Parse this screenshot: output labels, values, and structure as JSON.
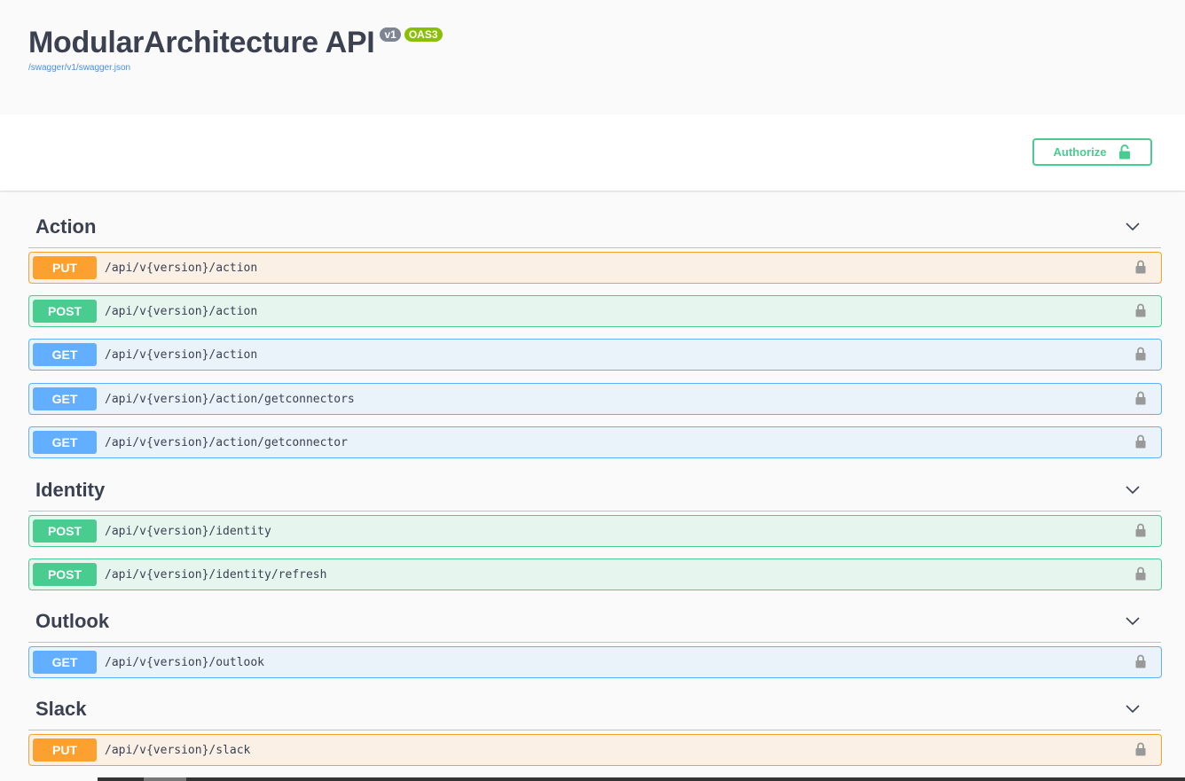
{
  "info": {
    "title": "ModularArchitecture API",
    "version_badge": "v1",
    "oas_badge": "OAS3",
    "spec_link": "/swagger/v1/swagger.json"
  },
  "scheme": {
    "authorize_label": "Authorize",
    "authorize_icon": "lock-open-icon"
  },
  "colors": {
    "put": "#fca130",
    "post": "#49cc90",
    "get": "#61affe",
    "badge_version": "#7d8492",
    "badge_oas": "#89bf04",
    "link": "#4990e2"
  },
  "tags": [
    {
      "name": "Action",
      "operations": [
        {
          "method": "PUT",
          "path": "/api/v{version}/action"
        },
        {
          "method": "POST",
          "path": "/api/v{version}/action"
        },
        {
          "method": "GET",
          "path": "/api/v{version}/action"
        },
        {
          "method": "GET",
          "path": "/api/v{version}/action/getconnectors"
        },
        {
          "method": "GET",
          "path": "/api/v{version}/action/getconnector"
        }
      ]
    },
    {
      "name": "Identity",
      "operations": [
        {
          "method": "POST",
          "path": "/api/v{version}/identity"
        },
        {
          "method": "POST",
          "path": "/api/v{version}/identity/refresh"
        }
      ]
    },
    {
      "name": "Outlook",
      "operations": [
        {
          "method": "GET",
          "path": "/api/v{version}/outlook"
        }
      ]
    },
    {
      "name": "Slack",
      "operations": [
        {
          "method": "PUT",
          "path": "/api/v{version}/slack"
        }
      ]
    }
  ]
}
